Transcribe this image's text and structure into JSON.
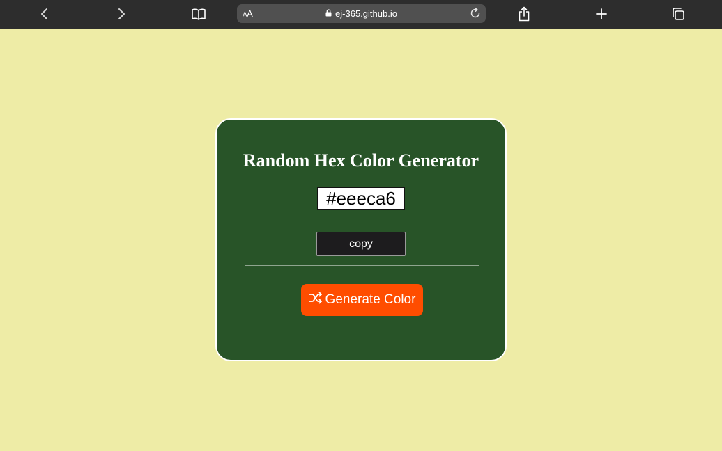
{
  "browser": {
    "aa_label_small": "A",
    "aa_label_large": "A",
    "url": "ej-365.github.io",
    "icons": {
      "back": "chevron-left-icon",
      "forward": "chevron-right-icon",
      "bookmarks": "book-icon",
      "lock": "lock-icon",
      "reload": "reload-icon",
      "share": "share-icon",
      "new_tab": "plus-icon",
      "tabs": "tabs-icon"
    }
  },
  "app": {
    "title": "Random Hex Color Generator",
    "hex_value": "#eeeca6",
    "copy_label": "copy",
    "generate_label": "Generate Color",
    "generate_icon": "shuffle-icon"
  },
  "colors": {
    "page_background": "#eeeca6",
    "card_background": "#285428",
    "generate_button": "#ff4d00",
    "copy_button": "#1d1c1e",
    "toolbar": "#2d2d2d"
  }
}
